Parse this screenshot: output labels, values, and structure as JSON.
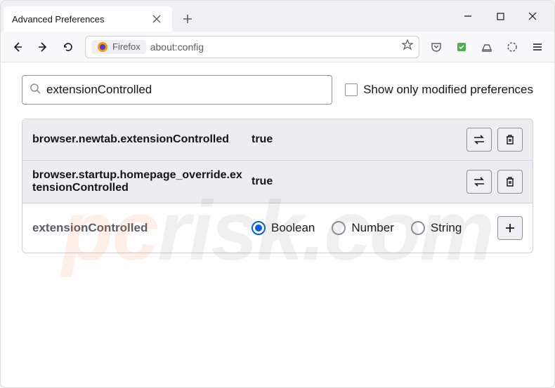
{
  "window": {
    "tab_title": "Advanced Preferences",
    "identity_label": "Firefox",
    "url": "about:config"
  },
  "search": {
    "value": "extensionControlled",
    "only_modified_label": "Show only modified preferences"
  },
  "prefs": [
    {
      "name": "browser.newtab.extensionControlled",
      "value": "true"
    },
    {
      "name": "browser.startup.homepage_override.extensionControlled",
      "value": "true"
    }
  ],
  "new_pref": {
    "name": "extensionControlled",
    "types": [
      "Boolean",
      "Number",
      "String"
    ],
    "selected": "Boolean"
  }
}
